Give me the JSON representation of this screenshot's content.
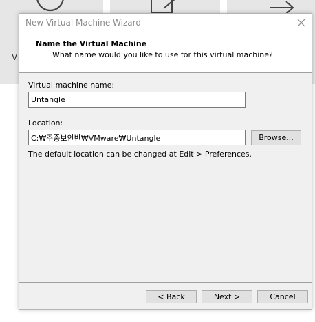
{
  "background": {
    "partial_label": "V"
  },
  "dialog": {
    "title": "New Virtual Machine Wizard",
    "header": {
      "title": "Name the Virtual Machine",
      "subtitle": "What name would you like to use for this virtual machine?"
    },
    "vm_name": {
      "label": "Virtual machine name:",
      "value": "Untangle"
    },
    "location": {
      "label": "Location:",
      "value": "C:₩주중보안반₩VMware₩Untangle",
      "browse_label": "Browse..."
    },
    "hint": "The default location can be changed at Edit > Preferences.",
    "buttons": {
      "back": "< Back",
      "next": "Next >",
      "cancel": "Cancel"
    }
  },
  "colors": {
    "dialog_bg": "#f0f0f0",
    "header_bg": "#ffffff",
    "title_text": "#8a8a8a",
    "button_bg": "#e1e1e1",
    "button_border": "#adadad"
  }
}
